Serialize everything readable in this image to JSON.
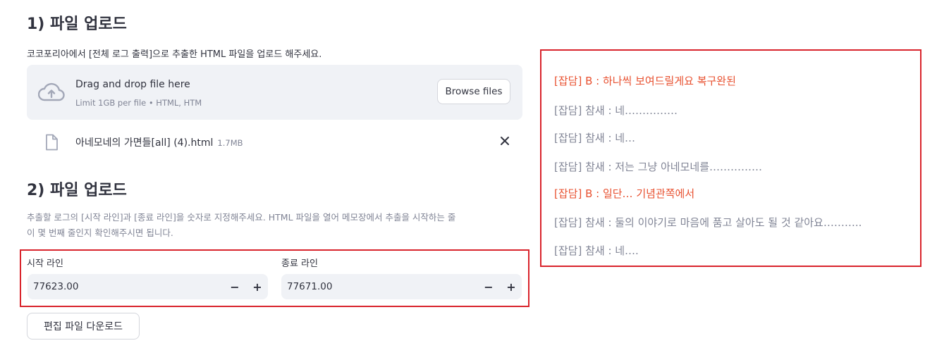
{
  "section1": {
    "title": "1) 파일 업로드",
    "description": "코코포리아에서 [전체 로그 출력]으로 추출한 HTML 파일을 업로드 해주세요.",
    "dropzone": {
      "icon": "cloud-upload-icon",
      "title": "Drag and drop file here",
      "limit": "Limit 1GB per file • HTML, HTM",
      "browse_label": "Browse files"
    },
    "uploaded_file": {
      "icon": "file-icon",
      "name": "아네모네의 가면들[all] (4).html",
      "size": "1.7MB",
      "remove_icon": "close-icon"
    }
  },
  "section2": {
    "title": "2) 파일 업로드",
    "description_line1": "추출할 로그의 [시작 라인]과 [종료 라인]을 숫자로 지정해주세요. HTML 파일을 열어 메모장에서 추출을 시작하는 줄",
    "description_line2": "이 몇 번째 줄인지 확인해주시면 됩니다.",
    "start": {
      "label": "시작 라인",
      "value": "77623.00"
    },
    "end": {
      "label": "종료 라인",
      "value": "77671.00"
    },
    "minus": "−",
    "plus": "+",
    "download_label": "편집 파일 다운로드"
  },
  "log": {
    "lines": [
      {
        "text": "[잡담] B : 하나씩 보여드릴게요 복구완된",
        "color": "#e8502f"
      },
      {
        "text": "[잡담] 참새 : 네……………",
        "color": "#808495"
      },
      {
        "text": "[잡담] 참새 : 네…",
        "color": "#808495"
      },
      {
        "text": "[잡담] 참새 : 저는 그냥 아네모네를……………",
        "color": "#808495"
      },
      {
        "text": "[잡담] B : 일단… 기념관쪽에서",
        "color": "#e8502f"
      },
      {
        "text": "[잡담] 참새 : 둘의 이야기로 마음에 품고 살아도 될 것 같아요………..",
        "color": "#808495"
      },
      {
        "text": "[잡담] 참새 : 네….",
        "color": "#808495"
      }
    ]
  },
  "colors": {
    "highlight_border": "#d9242c",
    "accent_text": "#e8502f",
    "muted_text": "#808495",
    "widget_bg": "#f0f2f6"
  }
}
